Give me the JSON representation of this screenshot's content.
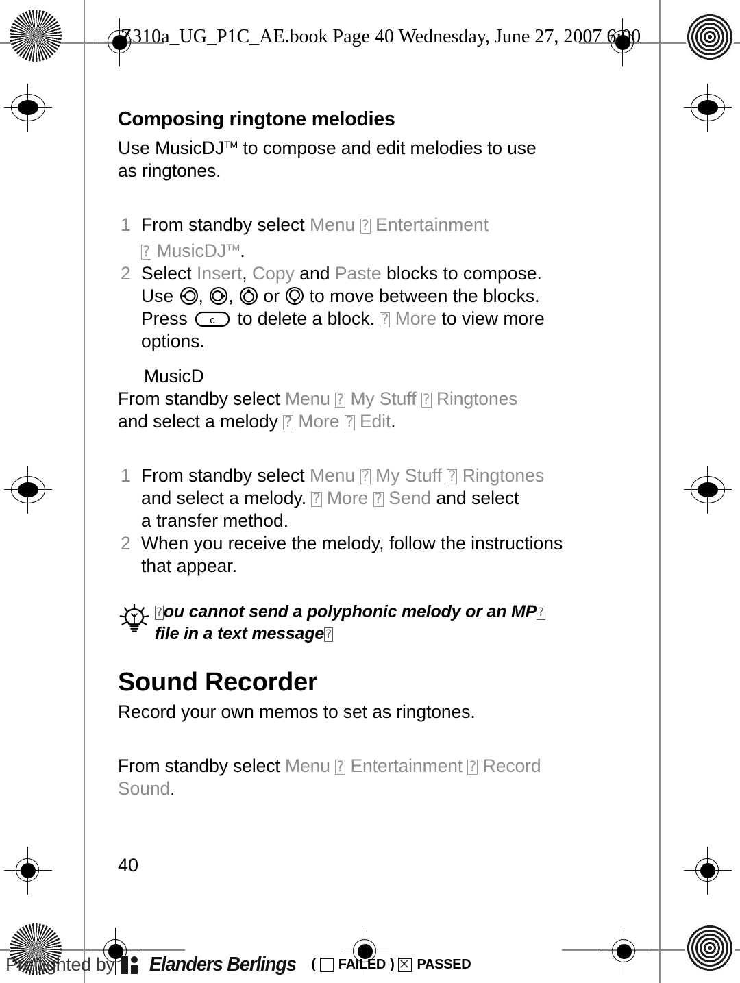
{
  "header": {
    "book_line": "Z310a_UG_P1C_AE.book  Page 40  Wednesday, June 27, 2007  6:00",
    "truncated": true
  },
  "page_number": "40",
  "content": {
    "section1": {
      "heading": "Composing ringtone melodies",
      "intro_line1_pre": "Use MusicDJ",
      "intro_tm": "TM",
      "intro_line1_post": " to compose and edit melodies to use",
      "intro_line2": "as ringtones.",
      "steps": [
        {
          "num": "1",
          "line1_pre": "From standby select ",
          "menu1": "Menu",
          "menu2": "Entertainment",
          "line2_menu": "MusicDJ",
          "line2_tm": "TM",
          "line2_end": "."
        },
        {
          "num": "2",
          "l1_pre": "Select ",
          "l1_insert": "Insert",
          "l1_mid1": ", ",
          "l1_copy": "Copy",
          "l1_mid2": " and ",
          "l1_paste": "Paste",
          "l1_post": " blocks to compose.",
          "l2_pre": "Use ",
          "l2_mid": " or ",
          "l2_post": " to move between the blocks.",
          "l3_pre": "Press ",
          "l3_mid": " to delete a block. ",
          "l3_more": "More",
          "l3_post": " to view more",
          "l4": "options."
        }
      ]
    },
    "section2": {
      "stray_heading": "MusicD",
      "line1_pre": "From standby select ",
      "menu1": "Menu",
      "menu2": "My Stuff",
      "menu3": "Ringtones",
      "line2_pre": "and select a melody ",
      "menu4": "More",
      "menu5": "Edit",
      "line2_end": "."
    },
    "section3": {
      "steps": [
        {
          "num": "1",
          "l1_pre": "From standby select ",
          "menu1": "Menu",
          "menu2": "My Stuff",
          "menu3": "Ringtones",
          "l2_pre": "and select a melody. ",
          "menu4": "More",
          "menu5": "Send",
          "l2_post": " and select",
          "l3": "a transfer method."
        },
        {
          "num": "2",
          "l1": "When you receive the melody, follow the instructions",
          "l2": "that appear."
        }
      ]
    },
    "tip": {
      "icon": "lightbulb-icon",
      "line1_box1": "?",
      "line1_mid": "ou cannot send a polyphonic melody or an MP",
      "line1_box2": "?",
      "line2_pre": "file in a text message",
      "line2_box": "?"
    },
    "section4": {
      "heading": "Sound Recorder",
      "intro": "Record your own memos to set as ringtones.",
      "line1_pre": "From standby select ",
      "menu1": "Menu",
      "menu2": "Entertainment",
      "menu3": "Record",
      "menu4": "Sound",
      "line_end": "."
    }
  },
  "separator_glyph": "?",
  "footer": {
    "preflight_text": "Preflighted by",
    "brand": "Elanders Berlings",
    "paren_open": "(",
    "failed_label": "FAILED",
    "paren_close": ")",
    "passed_label": "PASSED"
  },
  "colors": {
    "menu_gray": "#8c8c8c",
    "text_black": "#000000",
    "mark_gray": "#8a8a8a"
  }
}
